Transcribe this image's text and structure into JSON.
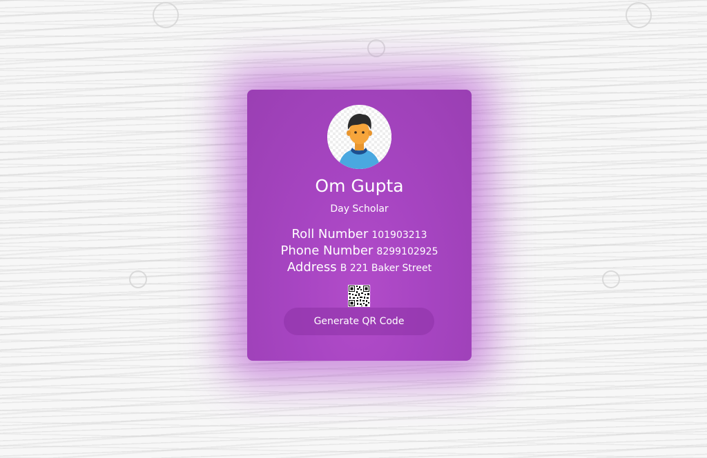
{
  "profile": {
    "name": "Om Gupta",
    "role": "Day Scholar",
    "roll": {
      "label": "Roll Number",
      "value": "101903213"
    },
    "phone": {
      "label": "Phone Number",
      "value": "8299102925"
    },
    "address": {
      "label": "Address",
      "value": "B 221 Baker Street"
    }
  },
  "actions": {
    "generate_qr_label": "Generate QR Code"
  },
  "icons": {
    "avatar": "user-avatar-icon",
    "qr": "qr-code-icon"
  },
  "colors": {
    "card": "#a745c2",
    "button": "#8c32a5",
    "text": "#ffffff"
  }
}
